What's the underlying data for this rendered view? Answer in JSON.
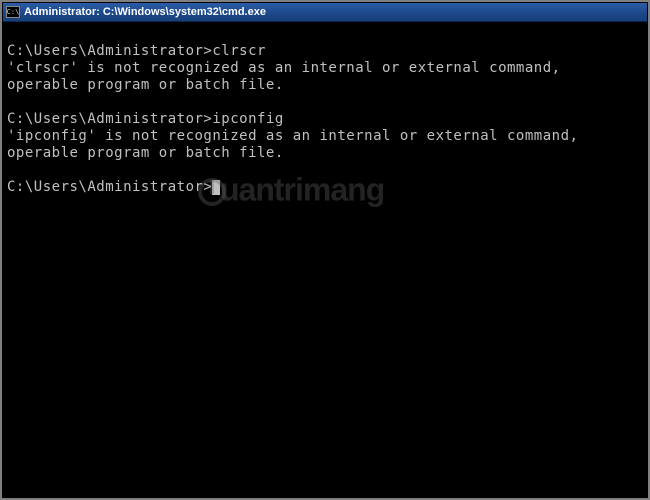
{
  "window": {
    "title": "Administrator: C:\\Windows\\system32\\cmd.exe",
    "icon_label": "C:\\"
  },
  "terminal": {
    "lines": [
      {
        "type": "blank"
      },
      {
        "type": "command",
        "prompt": "C:\\Users\\Administrator>",
        "command": "clrscr"
      },
      {
        "type": "text",
        "text": "'clrscr' is not recognized as an internal or external command,"
      },
      {
        "type": "text",
        "text": "operable program or batch file."
      },
      {
        "type": "blank"
      },
      {
        "type": "command",
        "prompt": "C:\\Users\\Administrator>",
        "command": "ipconfig"
      },
      {
        "type": "text",
        "text": "'ipconfig' is not recognized as an internal or external command,"
      },
      {
        "type": "text",
        "text": "operable program or batch file."
      },
      {
        "type": "blank"
      },
      {
        "type": "prompt",
        "prompt": "C:\\Users\\Administrator>"
      }
    ]
  },
  "watermark": {
    "text": "uantrimang"
  }
}
